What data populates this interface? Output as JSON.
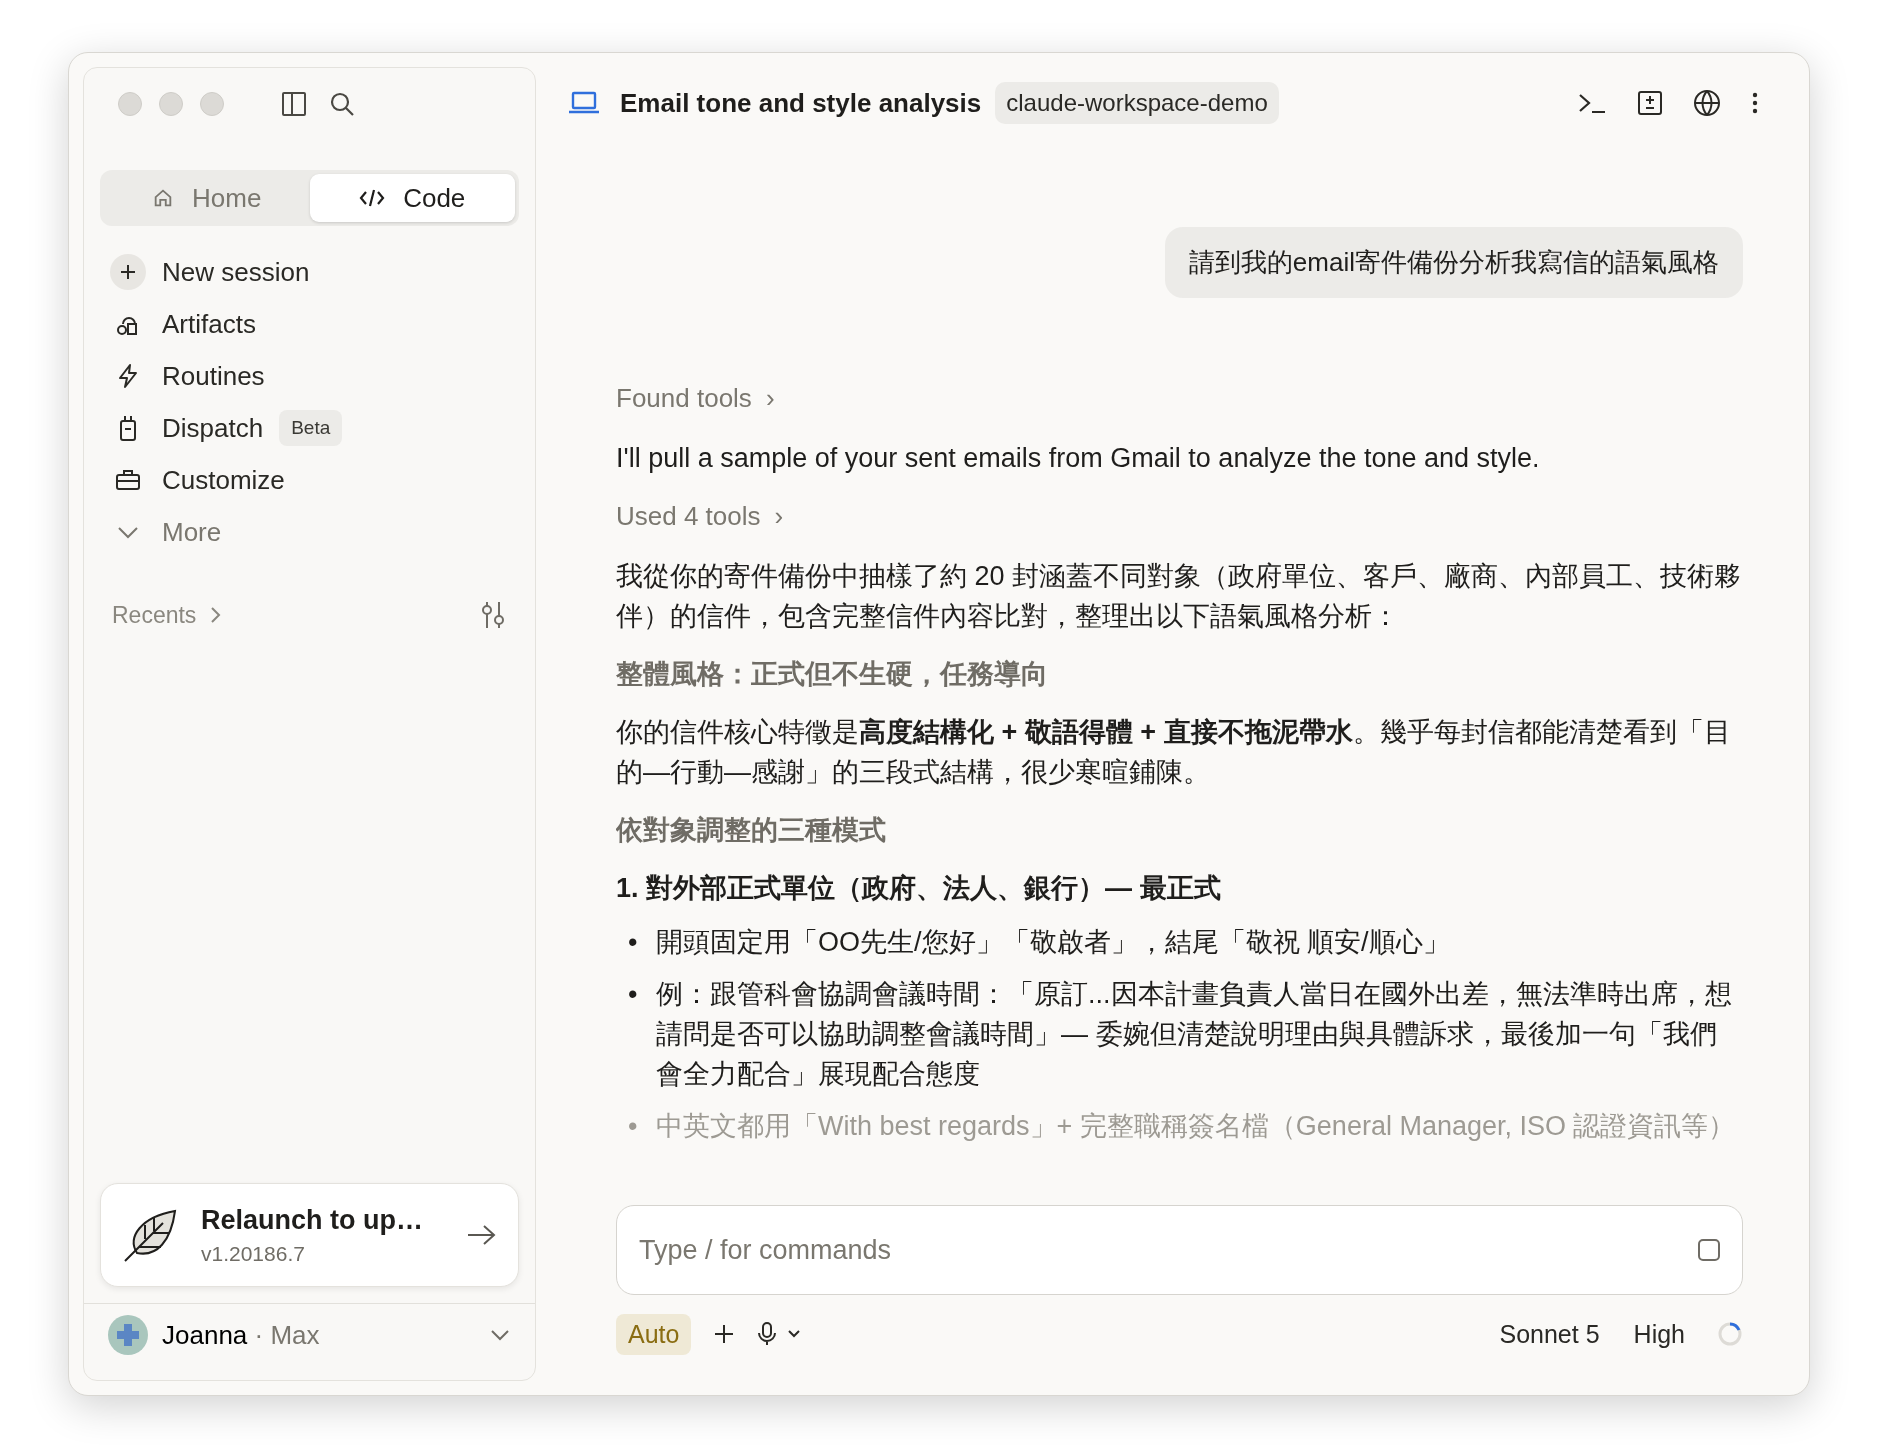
{
  "sidebar": {
    "tabs": [
      {
        "label": "Home",
        "selected": false
      },
      {
        "label": "Code",
        "selected": true
      }
    ],
    "nav": [
      {
        "label": "New session",
        "kind": "new"
      },
      {
        "label": "Artifacts",
        "kind": "page"
      },
      {
        "label": "Routines",
        "kind": "page"
      },
      {
        "label": "Dispatch",
        "kind": "page",
        "badge": "Beta"
      },
      {
        "label": "Customize",
        "kind": "page"
      },
      {
        "label": "More",
        "kind": "more"
      }
    ],
    "recents": "Recents",
    "update": {
      "title": "Relaunch to up…",
      "version": "v1.20186.7"
    },
    "account": {
      "name": "Joanna",
      "separator": "·",
      "plan": "Max"
    }
  },
  "header": {
    "title": "Email tone and style analysis",
    "workspace": "claude-workspace-demo"
  },
  "user_message": "請到我的email寄件備份分析我寫信的語氣風格",
  "blocks": [
    {
      "kind": "tools",
      "text": "Found tools",
      "chevron": "›"
    },
    {
      "kind": "paragraph",
      "text": "I'll pull a sample of your sent emails from Gmail to analyze the tone and style."
    },
    {
      "kind": "tools",
      "text": "Used 4 tools",
      "chevron": "›"
    },
    {
      "kind": "paragraph",
      "text": "我從你的寄件備份中抽樣了約 20 封涵蓋不同對象（政府單位、客戶、廠商、內部員工、技術夥伴）的信件，包含完整信件內容比對，整理出以下語氣風格分析："
    },
    {
      "kind": "heading",
      "text": "整體風格：正式但不生硬，任務導向"
    },
    {
      "kind": "paragraph",
      "text": "你的信件核心特徵是**高度結構化 + 敬語得體 + 直接不拖泥帶水**。幾乎每封信都能清楚看到「目的—行動—感謝」的三段式結構，很少寒暄鋪陳。"
    },
    {
      "kind": "heading",
      "text": "依對象調整的三種模式"
    },
    {
      "kind": "subheading",
      "text": "1. 對外部正式單位（政府、法人、銀行）— 最正式"
    },
    {
      "kind": "bullet",
      "text": "開頭固定用「OO先生/您好」「敬啟者」，結尾「敬祝 順安/順心」",
      "faded": false,
      "marker": "•"
    },
    {
      "kind": "bullet",
      "text": "例：跟管科會協調會議時間：「原訂...因本計畫負責人當日在國外出差，無法準時出席，想請問是否可以協助調整會議時間」— 委婉但清楚說明理由與具體訴求，最後加一句「我們會全力配合」展現配合態度",
      "faded": false,
      "marker": "•"
    },
    {
      "kind": "bullet",
      "text": "中英文都用「With best regards」+ 完整職稱簽名檔（General Manager, ISO 認證資訊等）",
      "faded": true,
      "marker": "•"
    }
  ],
  "composer": {
    "placeholder": "Type / for commands",
    "mode": "Auto",
    "model": "Sonnet 5",
    "effort": "High"
  }
}
